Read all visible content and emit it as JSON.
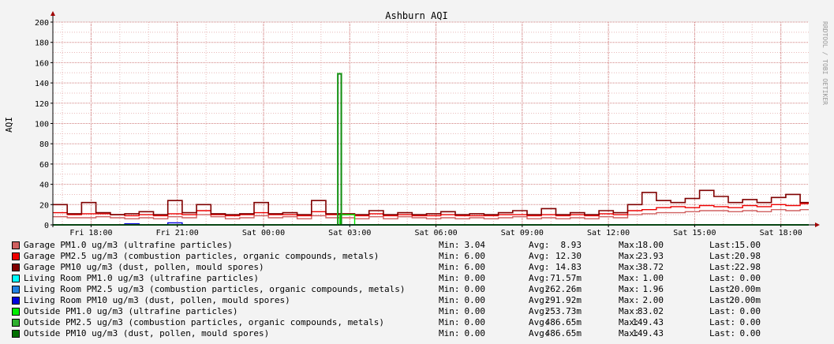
{
  "colors": {
    "background": "#f3f3f3",
    "canvas": "#ffffff",
    "grid_minor": "#e8b8b8",
    "grid_major": "#d08080",
    "axis": "#000000",
    "arrow": "#a00000"
  },
  "watermark": "RRDTOOL / TOBI OETIKER",
  "legend_labels": {
    "min": "Min:",
    "avg": "Avg:",
    "max": "Max:",
    "last": "Last:"
  },
  "chart_data": {
    "type": "line",
    "title": "Ashburn AQI",
    "ylabel": "AQI",
    "xlabel": "",
    "ylim": [
      0,
      200
    ],
    "yticks": [
      0,
      20,
      40,
      60,
      80,
      100,
      120,
      140,
      160,
      180,
      200
    ],
    "grid": true,
    "legend_position": "bottom",
    "x_unit": "hours since first sample (Fri ~16:40)",
    "xlim": [
      0,
      26.3
    ],
    "xticks": [
      {
        "label": "Fri 18:00",
        "x": 1.33
      },
      {
        "label": "Fri 21:00",
        "x": 4.33
      },
      {
        "label": "Sat 00:00",
        "x": 7.33
      },
      {
        "label": "Sat 03:00",
        "x": 10.33
      },
      {
        "label": "Sat 06:00",
        "x": 13.33
      },
      {
        "label": "Sat 09:00",
        "x": 16.33
      },
      {
        "label": "Sat 12:00",
        "x": 19.33
      },
      {
        "label": "Sat 15:00",
        "x": 22.33
      },
      {
        "label": "Sat 18:00",
        "x": 25.33
      }
    ],
    "x": [
      0,
      0.5,
      1,
      1.5,
      2,
      2.5,
      3,
      3.5,
      4,
      4.5,
      5,
      5.5,
      6,
      6.5,
      7,
      7.5,
      8,
      8.5,
      9,
      9.5,
      10,
      10.5,
      11,
      11.5,
      12,
      12.5,
      13,
      13.5,
      14,
      14.5,
      15,
      15.5,
      16,
      16.5,
      17,
      17.5,
      18,
      18.5,
      19,
      19.5,
      20,
      20.5,
      21,
      21.5,
      22,
      22.5,
      23,
      23.5,
      24,
      24.5,
      25,
      25.5,
      26
    ],
    "series": [
      {
        "name": "Garage PM1.0 ug/m3 (ultrafine particles)",
        "color": "#d06060",
        "stats": {
          "min": "3.04",
          "avg": "8.93",
          "max": "18.00",
          "last": "15.00"
        },
        "values": [
          8,
          7,
          7,
          8,
          7,
          6,
          7,
          6,
          8,
          7,
          10,
          8,
          6,
          7,
          9,
          7,
          8,
          6,
          9,
          7,
          7,
          6,
          8,
          6,
          8,
          7,
          6,
          7,
          6,
          7,
          6,
          7,
          8,
          6,
          7,
          6,
          7,
          6,
          8,
          7,
          10,
          11,
          12,
          12,
          13,
          14,
          14,
          13,
          14,
          13,
          15,
          14,
          15
        ]
      },
      {
        "name": "Garage PM2.5 ug/m3 (combustion particles, organic compounds, metals)",
        "color": "#ee0000",
        "stats": {
          "min": "6.00",
          "avg": "12.30",
          "max": "23.93",
          "last": "20.98"
        },
        "values": [
          12,
          10,
          11,
          11,
          10,
          9,
          10,
          9,
          11,
          10,
          14,
          10,
          9,
          10,
          12,
          10,
          10,
          9,
          13,
          10,
          10,
          9,
          11,
          9,
          10,
          9,
          9,
          10,
          9,
          9,
          9,
          10,
          10,
          9,
          10,
          9,
          10,
          9,
          11,
          10,
          14,
          15,
          17,
          18,
          17,
          19,
          18,
          17,
          19,
          18,
          20,
          19,
          21
        ]
      },
      {
        "name": "Garage PM10 ug/m3 (dust, pollen, mould spores)",
        "color": "#800000",
        "stats": {
          "min": "6.00",
          "avg": "14.83",
          "max": "38.72",
          "last": "22.98"
        },
        "values": [
          20,
          11,
          22,
          12,
          10,
          11,
          13,
          10,
          24,
          12,
          20,
          11,
          10,
          11,
          22,
          11,
          12,
          10,
          24,
          11,
          11,
          10,
          14,
          10,
          12,
          10,
          11,
          13,
          10,
          11,
          10,
          12,
          14,
          10,
          16,
          10,
          12,
          10,
          14,
          12,
          20,
          32,
          24,
          22,
          26,
          34,
          28,
          22,
          25,
          22,
          27,
          30,
          22
        ]
      },
      {
        "name": "Living Room PM1.0 ug/m3 (ultrafine particles)",
        "color": "#00ffff",
        "stats": {
          "min": "0.00",
          "avg": "71.57m",
          "max": "1.00",
          "last": "0.00"
        },
        "values": [
          0,
          0,
          0,
          0,
          0,
          0,
          0,
          0,
          0,
          0,
          0,
          0,
          0,
          0,
          0,
          0,
          0,
          0,
          0,
          0,
          0,
          0,
          0,
          0,
          0,
          0,
          0,
          0,
          0,
          0,
          0,
          0,
          0,
          0,
          0,
          0,
          0,
          0,
          0,
          0,
          0,
          0,
          0,
          0,
          0,
          0,
          0,
          0,
          0,
          0,
          0,
          0,
          0
        ]
      },
      {
        "name": "Living Room PM2.5 ug/m3 (combustion particles, organic compounds, metals)",
        "color": "#2080e0",
        "stats": {
          "min": "0.00",
          "avg": "262.26m",
          "max": "1.96",
          "last": "20.00m"
        },
        "values": [
          0,
          0,
          0,
          0,
          0,
          0,
          0,
          0,
          0,
          0,
          0,
          0,
          0,
          0,
          0,
          0,
          0,
          0,
          0,
          0,
          0,
          0,
          0,
          0,
          0,
          0,
          0,
          0,
          0,
          0,
          0,
          0,
          0,
          0,
          0,
          0,
          0,
          0,
          0,
          0,
          0,
          0,
          0,
          0,
          0,
          0,
          0,
          0,
          0,
          0,
          0,
          0,
          0
        ]
      },
      {
        "name": "Living Room PM10 ug/m3 (dust, pollen, mould spores)",
        "color": "#0000dd",
        "stats": {
          "min": "0.00",
          "avg": "291.92m",
          "max": "2.00",
          "last": "20.00m"
        },
        "values": [
          0,
          0,
          0,
          0,
          0,
          1,
          0,
          0,
          2,
          0,
          0,
          0,
          0,
          0,
          0,
          0,
          0,
          0,
          0,
          0,
          0,
          0,
          0,
          0,
          0,
          0,
          0,
          0,
          0,
          0,
          0,
          0,
          0,
          0,
          0,
          0,
          0,
          0,
          0,
          0,
          0,
          0,
          0,
          0,
          0,
          0,
          0,
          0,
          0,
          0,
          0,
          0,
          0
        ]
      },
      {
        "name": "Outside PM1.0 ug/m3 (ultrafine particles)",
        "color": "#00ee00",
        "stats": {
          "min": "0.00",
          "avg": "253.73m",
          "max": "83.02",
          "last": "0.00"
        },
        "values": [
          0,
          0,
          0,
          0,
          0,
          0,
          0,
          0,
          0,
          0,
          0,
          0,
          0,
          0,
          0,
          0,
          0,
          0,
          0,
          0,
          10,
          0,
          0,
          0,
          0,
          0,
          0,
          0,
          0,
          0,
          0,
          0,
          0,
          0,
          0,
          0,
          0,
          0,
          0,
          0,
          0,
          0,
          0,
          0,
          0,
          0,
          0,
          0,
          0,
          0,
          0,
          0,
          0
        ]
      },
      {
        "name": "Outside PM2.5 ug/m3 (combustion particles, organic compounds, metals)",
        "color": "#30b030",
        "stats": {
          "min": "0.00",
          "avg": "486.65m",
          "max": "149.43",
          "last": "0.00"
        },
        "values": [
          0,
          0,
          0,
          0,
          0,
          0,
          0,
          0,
          0,
          0,
          0,
          0,
          0,
          0,
          0,
          0,
          0,
          0,
          0,
          0,
          0,
          0,
          0,
          0,
          0,
          0,
          0,
          0,
          0,
          0,
          0,
          0,
          0,
          0,
          0,
          0,
          0,
          0,
          0,
          0,
          0,
          0,
          0,
          0,
          0,
          0,
          0,
          0,
          0,
          0,
          0,
          0,
          0
        ]
      },
      {
        "name": "Outside PM10 ug/m3 (dust, pollen, mould spores)",
        "color": "#007000",
        "stats": {
          "min": "0.00",
          "avg": "486.65m",
          "max": "149.43",
          "last": "0.00"
        },
        "values": [
          0,
          0,
          0,
          0,
          0,
          0,
          0,
          0,
          0,
          0,
          0,
          0,
          0,
          0,
          0,
          0,
          0,
          0,
          0,
          0,
          0,
          0,
          0,
          0,
          0,
          0,
          0,
          0,
          0,
          0,
          0,
          0,
          0,
          0,
          0,
          0,
          0,
          0,
          0,
          0,
          0,
          0,
          0,
          0,
          0,
          0,
          0,
          0,
          0,
          0,
          0,
          0,
          0
        ]
      }
    ],
    "spike": {
      "x_start": 9.9,
      "x_end": 10.05,
      "value": 149.43,
      "series": [
        6,
        7,
        8
      ]
    }
  }
}
